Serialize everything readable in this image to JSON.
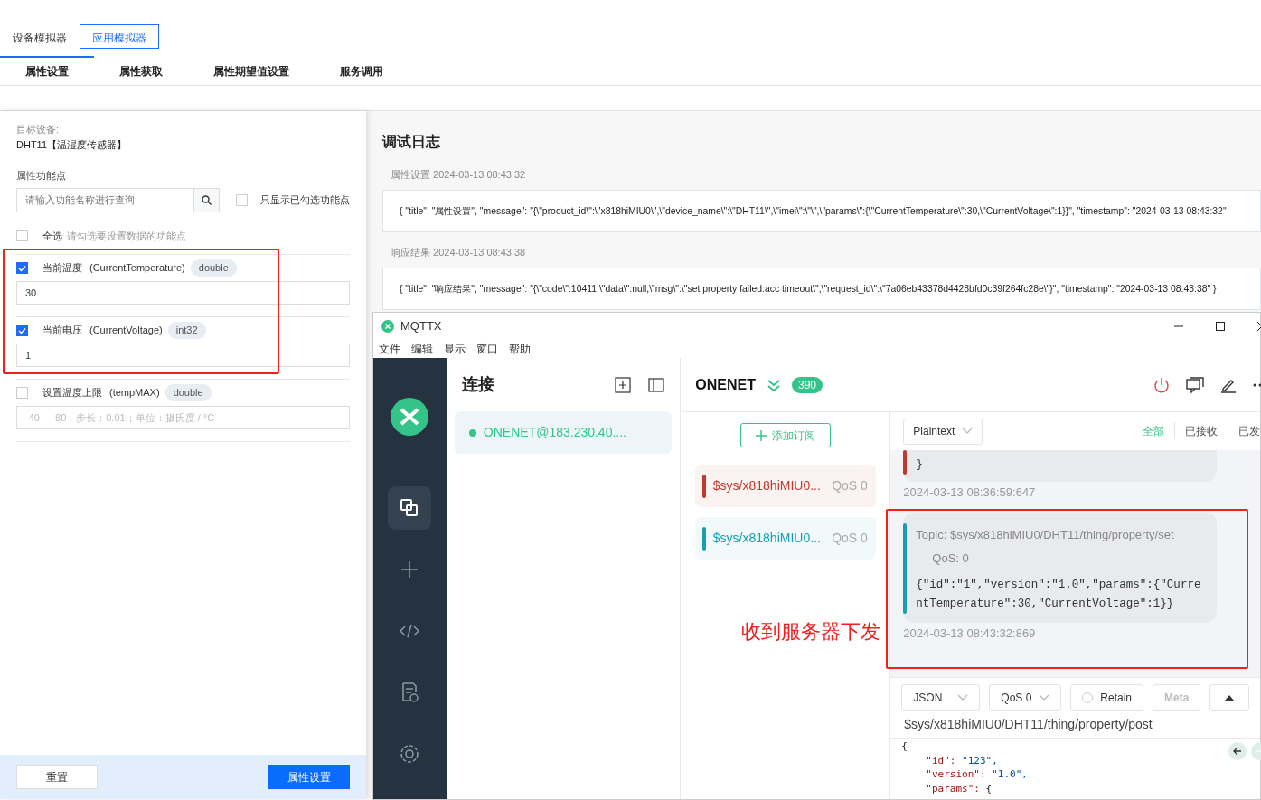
{
  "page_tabs": [
    {
      "label": "设备模拟器",
      "selected": false
    },
    {
      "label": "应用模拟器",
      "selected": true
    }
  ],
  "sub_tabs": [
    {
      "label": "属性设置",
      "selected": true
    },
    {
      "label": "属性获取",
      "selected": false
    },
    {
      "label": "属性期望值设置",
      "selected": false
    },
    {
      "label": "服务调用",
      "selected": false
    }
  ],
  "target": {
    "label": "目标设备:",
    "value": "DHT11【温湿度传感器】"
  },
  "properties": {
    "label": "属性功能点",
    "search_placeholder": "请输入功能名称进行查询",
    "only_checked": {
      "label": "只显示已勾选功能点",
      "checked": false
    },
    "select_all": {
      "label": "全选",
      "hint": "请勾选要设置数据的功能点",
      "checked": false
    },
    "items": [
      {
        "name": "当前温度",
        "identifier": "(CurrentTemperature)",
        "type": "double",
        "checked": true,
        "value": "30"
      },
      {
        "name": "当前电压",
        "identifier": "(CurrentVoltage)",
        "type": "int32",
        "checked": true,
        "value": "1"
      },
      {
        "name": "设置温度上限",
        "identifier": "(tempMAX)",
        "type": "double",
        "checked": false,
        "placeholder": "-40 — 80；步长：0.01；单位：摄氏度 / °C"
      }
    ]
  },
  "actions": [
    {
      "label": "重置",
      "kind": "secondary"
    },
    {
      "label": "属性设置",
      "kind": "primary"
    }
  ],
  "debug_log": {
    "title": "调试日志",
    "entries": [
      {
        "label": "属性设置 2024-03-13 08:43:32",
        "text": "{ \"title\": \"属性设置\", \"message\": \"{\\\"product_id\\\":\\\"x818hiMIU0\\\",\\\"device_name\\\":\\\"DHT11\\\",\\\"imei\\\":\\\"\\\",\\\"params\\\":{\\\"CurrentTemperature\\\":30,\\\"CurrentVoltage\\\":1}}\", \"timestamp\": \"2024-03-13 08:43:32\""
      },
      {
        "label": "响应结果 2024-03-13 08:43:38",
        "text": "{ \"title\": \"响应结果\", \"message\": \"{\\\"code\\\":10411,\\\"data\\\":null,\\\"msg\\\":\\\"set property failed:acc timeout\\\",\\\"request_id\\\":\\\"7a06eb43378d4428bfd0c39f264fc28e\\\"}\", \"timestamp\": \"2024-03-13 08:43:38\" }"
      }
    ]
  },
  "mqttx": {
    "title": "MQTTX",
    "menu": [
      "文件",
      "编辑",
      "显示",
      "窗口",
      "帮助"
    ],
    "sidebar": [
      {
        "kind": "connections",
        "selected": true
      },
      {
        "kind": "new",
        "selected": false
      },
      {
        "kind": "script",
        "selected": false
      },
      {
        "kind": "log",
        "selected": false
      },
      {
        "kind": "settings",
        "selected": false
      }
    ],
    "connections": {
      "title": "连接",
      "items": [
        {
          "label": "ONENET@183.230.40....",
          "selected": true
        }
      ]
    },
    "connection": {
      "name": "ONENET",
      "count": "390",
      "add_subscription": "添加订阅",
      "subscriptions": [
        {
          "topic": "$sys/x818hiMIU0...",
          "qos": "QoS 0",
          "color": "#c0392b"
        },
        {
          "topic": "$sys/x818hiMIU0...",
          "qos": "QoS 0",
          "color": "#1a9db0"
        }
      ],
      "format": "Plaintext",
      "filters": [
        {
          "label": "全部",
          "selected": true
        },
        {
          "label": "已接收",
          "selected": false
        },
        {
          "label": "已发",
          "selected": false
        }
      ],
      "messages": [
        {
          "body": "}",
          "color": "#c0392b",
          "time": "2024-03-13 08:36:59:647"
        },
        {
          "topic": "Topic: $sys/x818hiMIU0/DHT11/thing/property/set",
          "qos": "QoS: 0",
          "body": "{\"id\":\"1\",\"version\":\"1.0\",\"params\":{\"CurrentTemperature\":30,\"CurrentVoltage\":1}}",
          "color": "#1a9db0",
          "time": "2024-03-13 08:43:32:869"
        }
      ],
      "publish": {
        "format": "JSON",
        "qos": "QoS 0",
        "retain": {
          "label": "Retain",
          "checked": false
        },
        "meta": "Meta",
        "topic": "$sys/x818hiMIU0/DHT11/thing/property/post",
        "code": [
          {
            "key": "{"
          },
          {
            "key": "\"id\":",
            "value": "\"123\","
          },
          {
            "key": "\"version\":",
            "value": "\"1.0\","
          },
          {
            "key": "\"params\":",
            "value": "{"
          }
        ]
      }
    }
  },
  "annotation": {
    "text": "收到服务器下发"
  }
}
